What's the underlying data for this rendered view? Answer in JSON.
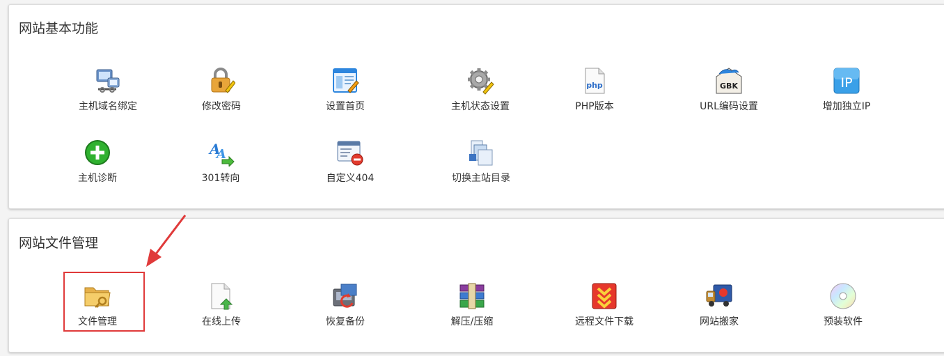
{
  "sections": [
    {
      "title": "网站基本功能",
      "items": [
        {
          "label": "主机域名绑定",
          "icon": "computer-network-icon"
        },
        {
          "label": "修改密码",
          "icon": "padlock-pencil-icon"
        },
        {
          "label": "设置首页",
          "icon": "webpage-edit-icon"
        },
        {
          "label": "主机状态设置",
          "icon": "gear-pencil-icon"
        },
        {
          "label": "PHP版本",
          "icon": "php-file-icon"
        },
        {
          "label": "URL编码设置",
          "icon": "gbk-icon"
        },
        {
          "label": "增加独立IP",
          "icon": "ip-icon"
        },
        {
          "label": "主机诊断",
          "icon": "green-plus-icon"
        },
        {
          "label": "301转向",
          "icon": "font-arrow-icon"
        },
        {
          "label": "自定义404",
          "icon": "window-minus-icon"
        },
        {
          "label": "切换主站目录",
          "icon": "directory-pages-icon"
        }
      ]
    },
    {
      "title": "网站文件管理",
      "items": [
        {
          "label": "文件管理",
          "icon": "folder-key-icon"
        },
        {
          "label": "在线上传",
          "icon": "file-upload-icon"
        },
        {
          "label": "恢复备份",
          "icon": "backup-restore-icon"
        },
        {
          "label": "解压/压缩",
          "icon": "archive-books-icon"
        },
        {
          "label": "远程文件下载",
          "icon": "download-chevron-icon"
        },
        {
          "label": "网站搬家",
          "icon": "moving-truck-icon"
        },
        {
          "label": "预装软件",
          "icon": "cd-disc-icon"
        }
      ]
    }
  ],
  "icon_texts": {
    "php": "php",
    "gbk": "GBK",
    "ip": "IP"
  },
  "colors": {
    "highlight": "#e03a3a",
    "accent_blue": "#2e86de",
    "green": "#2fb12f"
  }
}
